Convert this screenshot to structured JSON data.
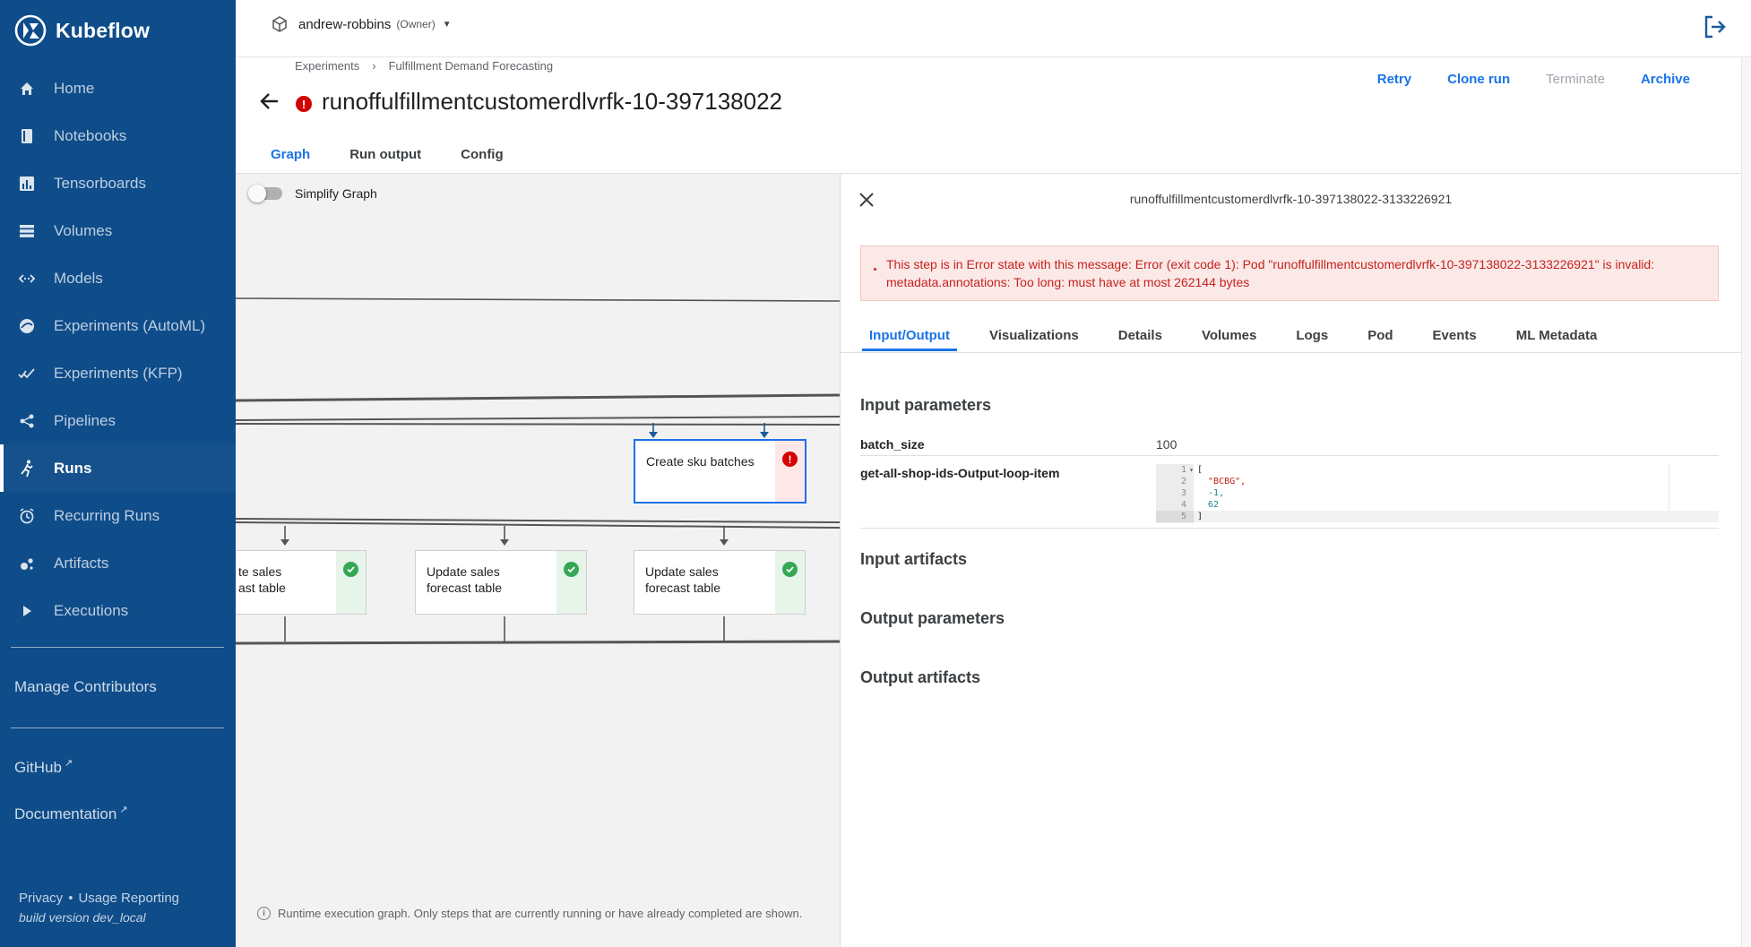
{
  "app": {
    "brand": "Kubeflow",
    "namespace": "andrew-robbins",
    "namespace_role": "(Owner)"
  },
  "sidebar": {
    "items": [
      {
        "label": "Home",
        "icon": "home-icon",
        "active": false
      },
      {
        "label": "Notebooks",
        "icon": "notebook-icon",
        "active": false
      },
      {
        "label": "Tensorboards",
        "icon": "tensorboard-icon",
        "active": false
      },
      {
        "label": "Volumes",
        "icon": "volumes-icon",
        "active": false
      },
      {
        "label": "Models",
        "icon": "models-icon",
        "active": false
      },
      {
        "label": "Experiments (AutoML)",
        "icon": "automl-icon",
        "active": false
      },
      {
        "label": "Experiments (KFP)",
        "icon": "kfp-icon",
        "active": false
      },
      {
        "label": "Pipelines",
        "icon": "pipelines-icon",
        "active": false
      },
      {
        "label": "Runs",
        "icon": "runs-icon",
        "active": true
      },
      {
        "label": "Recurring Runs",
        "icon": "recurring-runs-icon",
        "active": false
      },
      {
        "label": "Artifacts",
        "icon": "artifacts-icon",
        "active": false
      },
      {
        "label": "Executions",
        "icon": "executions-icon",
        "active": false
      }
    ],
    "manage_contributors": "Manage Contributors",
    "github": "GitHub",
    "documentation": "Documentation",
    "privacy": "Privacy",
    "usage_reporting": "Usage Reporting",
    "build_version": "build version dev_local"
  },
  "header": {
    "breadcrumb": [
      "Experiments",
      "Fulfillment Demand Forecasting"
    ],
    "title": "runoffulfillmentcustomerdlvrfk-10-397138022",
    "status": "error",
    "actions": [
      {
        "label": "Retry",
        "enabled": true
      },
      {
        "label": "Clone run",
        "enabled": true
      },
      {
        "label": "Terminate",
        "enabled": false
      },
      {
        "label": "Archive",
        "enabled": true
      }
    ],
    "tabs": [
      "Graph",
      "Run output",
      "Config"
    ],
    "active_tab": "Graph"
  },
  "graph": {
    "simplify_label": "Simplify Graph",
    "simplify_on": false,
    "nodes": [
      {
        "label": "Create sku batches",
        "status": "error"
      },
      {
        "label": "Update sales forecast table",
        "status": "succeeded",
        "partial_text": "te sales\nast table"
      },
      {
        "label": "Update sales forecast table",
        "status": "succeeded"
      },
      {
        "label": "Update sales forecast table",
        "status": "succeeded"
      }
    ],
    "footnote": "Runtime execution graph. Only steps that are currently running or have already completed are shown."
  },
  "details": {
    "node_id": "runoffulfillmentcustomerdlvrfk-10-397138022-3133226921",
    "error_message": "This step is in Error state with this message: Error (exit code 1): Pod \"runoffulfillmentcustomerdlvrfk-10-397138022-3133226921\" is invalid: metadata.annotations: Too long: must have at most 262144 bytes",
    "tabs": [
      "Input/Output",
      "Visualizations",
      "Details",
      "Volumes",
      "Logs",
      "Pod",
      "Events",
      "ML Metadata"
    ],
    "active_tab": "Input/Output",
    "input_parameters_title": "Input parameters",
    "input_parameters": [
      {
        "name": "batch_size",
        "value": "100"
      },
      {
        "name": "get-all-shop-ids-Output-loop-item",
        "value": "[\"BCBG\", -1, 62]"
      }
    ],
    "code_lines": [
      "[",
      "  \"BCBG\",",
      "  -1,",
      "  62",
      "]"
    ],
    "input_artifacts_title": "Input artifacts",
    "output_parameters_title": "Output parameters",
    "output_artifacts_title": "Output artifacts"
  },
  "colors": {
    "sidebar_bg": "#0f4c8a",
    "accent": "#1a73e8",
    "error": "#d50000",
    "success": "#34a853"
  }
}
